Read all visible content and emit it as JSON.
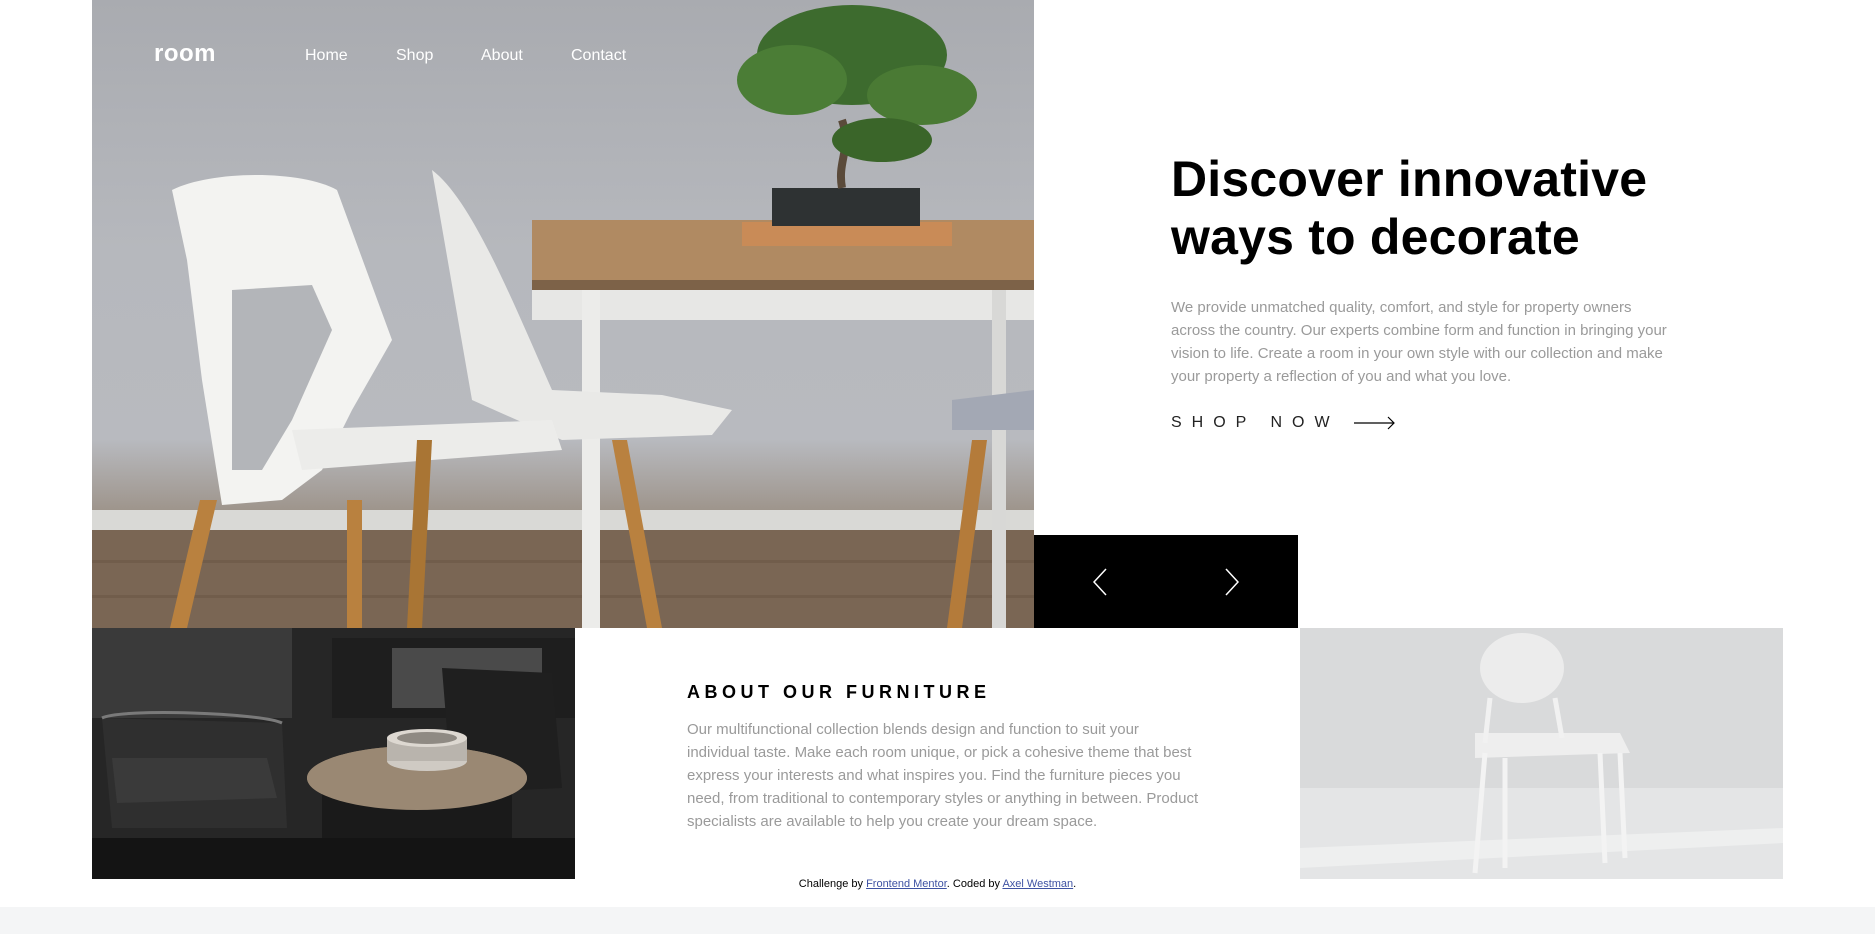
{
  "header": {
    "logo": "room",
    "nav": [
      "Home",
      "Shop",
      "About",
      "Contact"
    ]
  },
  "hero": {
    "title_line1": "Discover innovative",
    "title_line2": "ways to decorate",
    "description": "We provide unmatched quality, comfort, and style for property owners across the country. Our experts combine form and function in bringing your vision to life. Create a room in your own style with our collection and make your property a reflection of you and what you love.",
    "cta_label": "SHOP NOW",
    "cta_icon": "arrow-right-icon"
  },
  "slider": {
    "prev_icon": "chevron-left-icon",
    "next_icon": "chevron-right-icon"
  },
  "about": {
    "title": "ABOUT OUR FURNITURE",
    "description": "Our multifunctional collection blends design and function to suit your individual taste. Make each room unique, or pick a cohesive theme that best express your interests and what inspires you. Find the furniture pieces you need, from traditional to contemporary styles or anything in between. Product specialists are available to help you create your dream space."
  },
  "attribution": {
    "prefix": "Challenge by",
    "link1": "Frontend Mentor",
    "middle": ". Coded by",
    "link2": "Axel Westman",
    "suffix": "."
  },
  "colors": {
    "text_primary": "#000000",
    "text_muted": "#9a9a9a",
    "slider_bg": "#000000",
    "link": "#3e52a3"
  }
}
